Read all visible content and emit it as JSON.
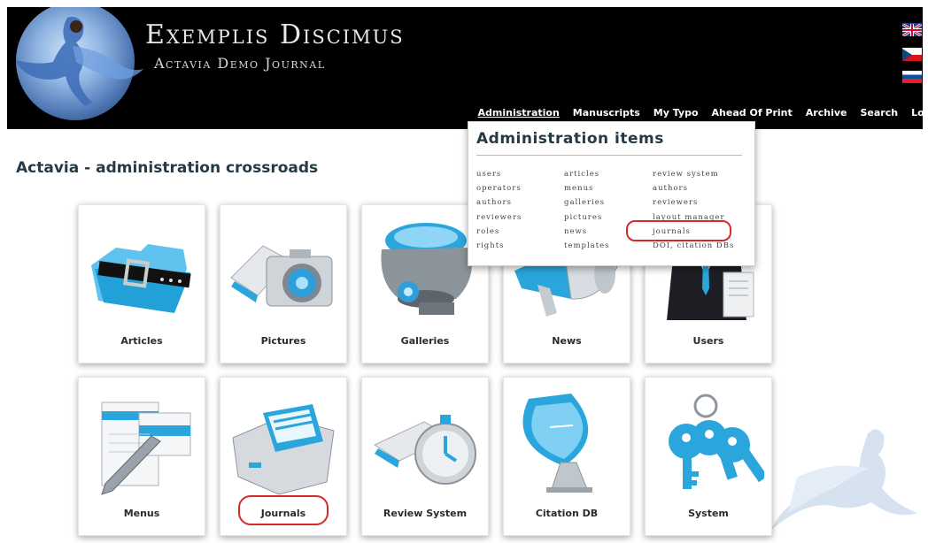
{
  "header": {
    "title": "Exemplis Discimus",
    "subtitle": "Actavia Demo Journal",
    "languages": [
      "english-flag",
      "czech-flag",
      "slovak-flag"
    ]
  },
  "nav": {
    "items": [
      "Administration",
      "Manuscripts",
      "My Typo",
      "Ahead Of Print",
      "Archive",
      "Search",
      "Logout"
    ],
    "active": "Administration"
  },
  "page": {
    "heading": "Actavia - administration crossroads"
  },
  "dropdown": {
    "title": "Administration items",
    "columns": [
      [
        "users",
        "operators",
        "authors",
        "reviewers",
        "roles",
        "rights"
      ],
      [
        "articles",
        "menus",
        "galleries",
        "pictures",
        "news",
        "templates"
      ],
      [
        "review system",
        "authors",
        "reviewers",
        "layout manager",
        "journals",
        "DOI, citation DBs"
      ]
    ],
    "highlighted": "journals"
  },
  "tiles": [
    {
      "label": "Articles",
      "icon": "folder-icon"
    },
    {
      "label": "Pictures",
      "icon": "camera-icon"
    },
    {
      "label": "Galleries",
      "icon": "projector-icon"
    },
    {
      "label": "News",
      "icon": "megaphone-icon"
    },
    {
      "label": "Users",
      "icon": "user-icon"
    },
    {
      "label": "Menus",
      "icon": "document-pen-icon"
    },
    {
      "label": "Journals",
      "icon": "file-drawer-icon"
    },
    {
      "label": "Review System",
      "icon": "stopwatch-icon"
    },
    {
      "label": "Citation DB",
      "icon": "satellite-dish-icon"
    },
    {
      "label": "System",
      "icon": "keys-icon"
    }
  ],
  "highlighted_tile": "Journals",
  "colors": {
    "header_bg": "#000000",
    "accent_blue": "#29a8e0",
    "heading": "#263a46",
    "highlight_red": "#d62a2a"
  }
}
